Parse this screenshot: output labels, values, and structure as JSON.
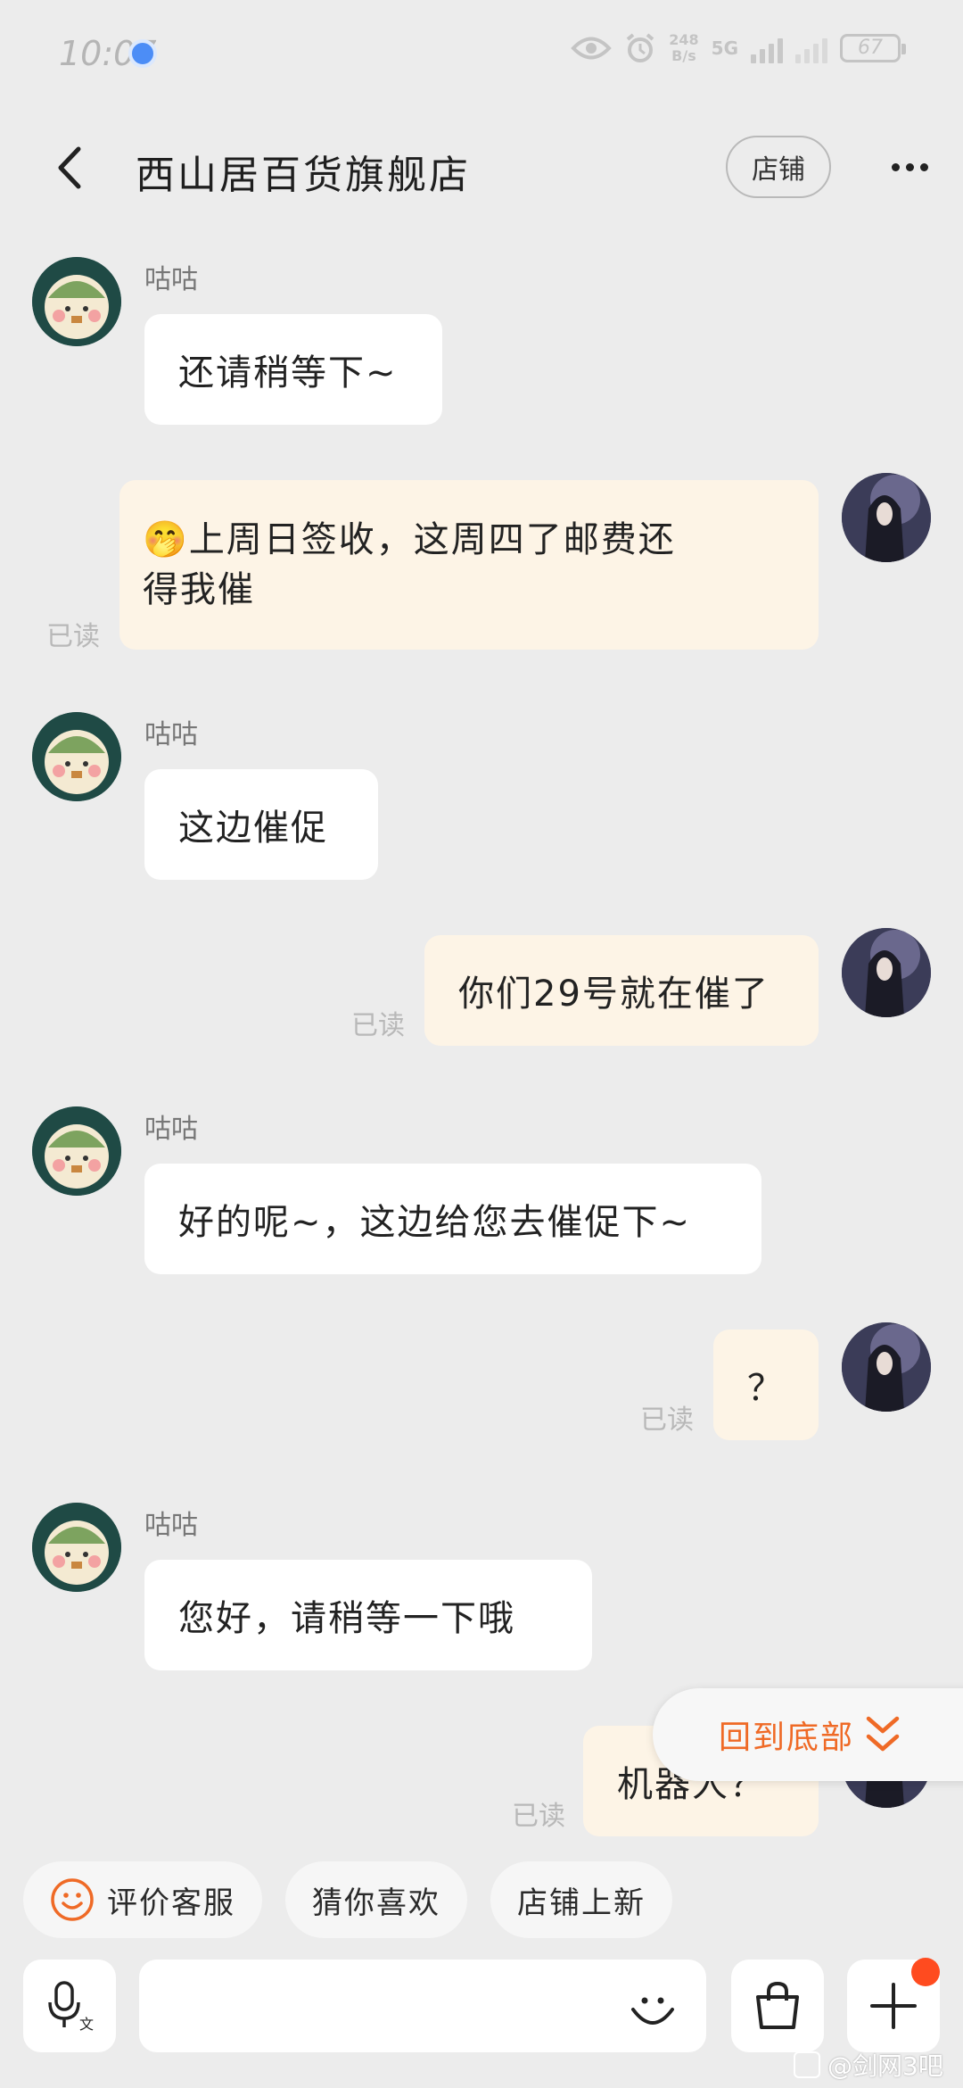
{
  "status_bar": {
    "time": "10:07",
    "net_speed_value": "248",
    "net_speed_unit": "B/s",
    "network_type": "5G",
    "battery": "67"
  },
  "header": {
    "title": "西山居百货旗舰店",
    "shop_button": "店铺"
  },
  "messages": [
    {
      "side": "left",
      "sender": "咕咕",
      "text": "还请稍等下~"
    },
    {
      "side": "right",
      "emoji": "🤭",
      "line1": "上周日签收，这周四了邮费还",
      "line2": "得我催",
      "read": "已读"
    },
    {
      "side": "left",
      "sender": "咕咕",
      "text": "这边催促"
    },
    {
      "side": "right",
      "text": "你们29号就在催了",
      "read": "已读"
    },
    {
      "side": "left",
      "sender": "咕咕",
      "text": "好的呢~，这边给您去催促下~"
    },
    {
      "side": "right",
      "text": "？",
      "read": "已读"
    },
    {
      "side": "left",
      "sender": "咕咕",
      "text": "您好，请稍等一下哦"
    },
    {
      "side": "right",
      "text": "机器人？",
      "read": "已读"
    }
  ],
  "back_to_bottom": "回到底部",
  "quick_chips": [
    "评价客服",
    "猜你喜欢",
    "店铺上新"
  ],
  "input": {
    "placeholder": "",
    "value": ""
  },
  "watermark": "@剑网3吧",
  "colors": {
    "accent": "#ef6a26",
    "my_bubble": "#fdf4e6",
    "background": "#ececec",
    "notification_dot": "#ff4b1f"
  }
}
